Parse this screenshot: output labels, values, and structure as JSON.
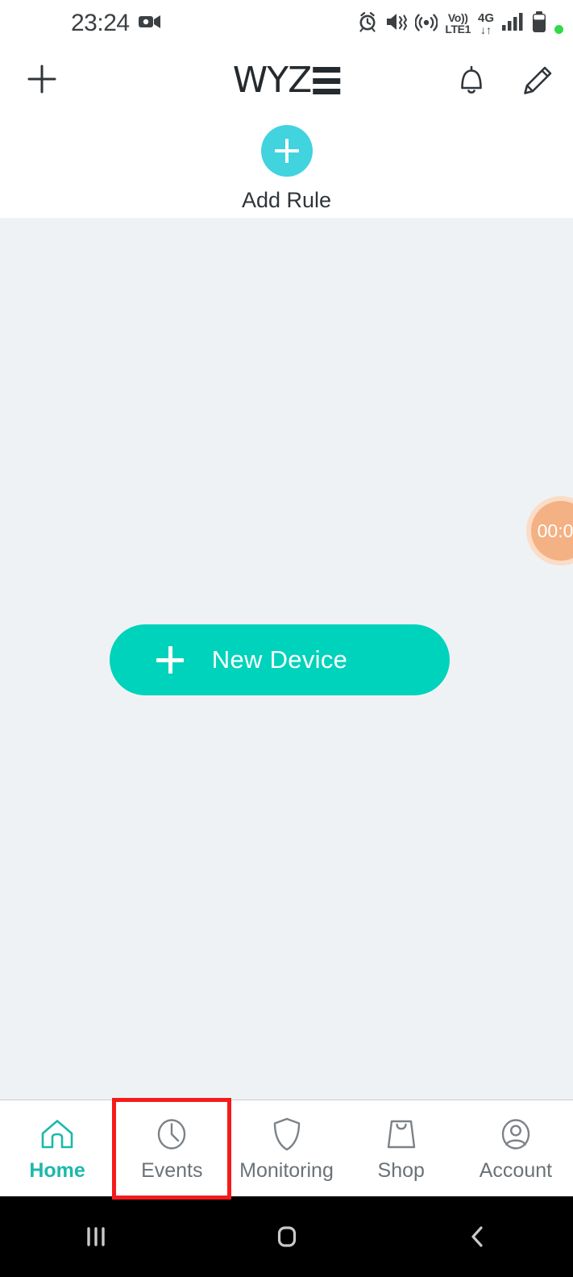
{
  "status_bar": {
    "time": "23:24",
    "camera_icon": "video-camera-recording-icon",
    "icons": [
      "alarm-clock-icon",
      "vibrate-mute-icon",
      "hotspot-icon"
    ],
    "volte": {
      "line1": "Vo))",
      "line2": "LTE1"
    },
    "network": {
      "gen": "4G",
      "arrows": "↓↑"
    },
    "signal_icon": "signal-bars-icon",
    "battery_icon": "battery-icon",
    "indicator_dot_color": "#32d94a"
  },
  "header": {
    "add_icon": "plus-icon",
    "logo_text": "WYZ",
    "logo_name": "WYZE",
    "notification_icon": "bell-icon",
    "edit_icon": "pencil-icon"
  },
  "add_rule": {
    "label": "Add Rule",
    "icon": "plus-icon",
    "circle_color": "#41d3de"
  },
  "main": {
    "background_color": "#eff2f5",
    "new_device": {
      "label": "New Device",
      "icon": "plus-icon",
      "color": "#00d3bb"
    },
    "timer_badge": {
      "label": "00:0",
      "color": "#f4b183"
    }
  },
  "tab_bar": {
    "active_color": "#1bb9ab",
    "inactive_color": "#6b7277",
    "highlight_color": "#f51b1b",
    "tabs": [
      {
        "label": "Home",
        "icon": "home-icon",
        "active": true,
        "highlighted": false
      },
      {
        "label": "Events",
        "icon": "clock-icon",
        "active": false,
        "highlighted": true
      },
      {
        "label": "Monitoring",
        "icon": "shield-icon",
        "active": false,
        "highlighted": false
      },
      {
        "label": "Shop",
        "icon": "shopping-bag-icon",
        "active": false,
        "highlighted": false
      },
      {
        "label": "Account",
        "icon": "user-circle-icon",
        "active": false,
        "highlighted": false
      }
    ]
  },
  "android_nav": {
    "recents_icon": "recents-icon",
    "home_icon": "home-square-icon",
    "back_icon": "back-chevron-icon"
  }
}
